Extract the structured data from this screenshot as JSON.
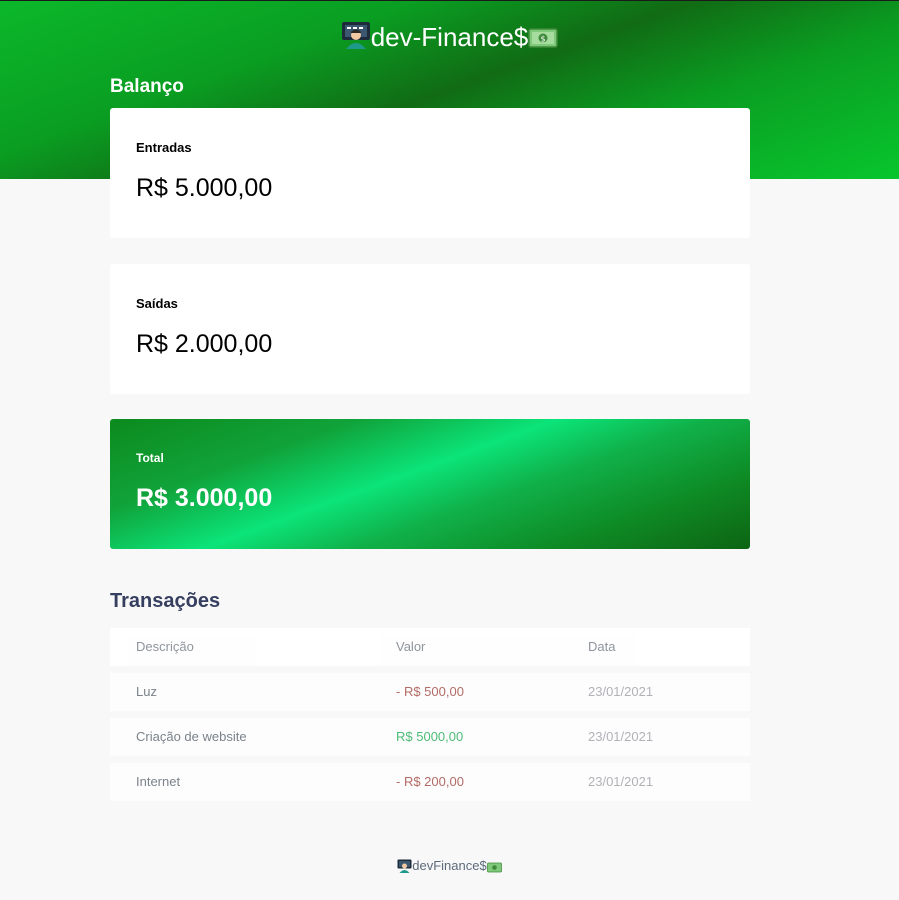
{
  "header": {
    "logo_prefix_icon": "computer-person-icon",
    "logo_text": "dev-Finance$",
    "logo_suffix_icon": "dollar-banknote-icon"
  },
  "balance": {
    "title": "Balanço",
    "income": {
      "label": "Entradas",
      "value": "R$ 5.000,00"
    },
    "expense": {
      "label": "Saídas",
      "value": "R$ 2.000,00"
    },
    "total": {
      "label": "Total",
      "value": "R$ 3.000,00"
    }
  },
  "transactions": {
    "title": "Transações",
    "columns": [
      "Descrição",
      "Valor",
      "Data"
    ],
    "rows": [
      {
        "description": "Luz",
        "amount": "- R$ 500,00",
        "date": "23/01/2021",
        "type": "expense"
      },
      {
        "description": "Criação de website",
        "amount": "R$ 5000,00",
        "date": "23/01/2021",
        "type": "income"
      },
      {
        "description": "Internet",
        "amount": "- R$ 200,00",
        "date": "23/01/2021",
        "type": "expense"
      }
    ]
  },
  "footer": {
    "text": "devFinance$"
  },
  "colors": {
    "header_green": "#0a9e22",
    "total_green": "#0be479",
    "expense_red": "#9b3c34",
    "income_green": "#14a84a",
    "title_navy": "#363f5f"
  }
}
